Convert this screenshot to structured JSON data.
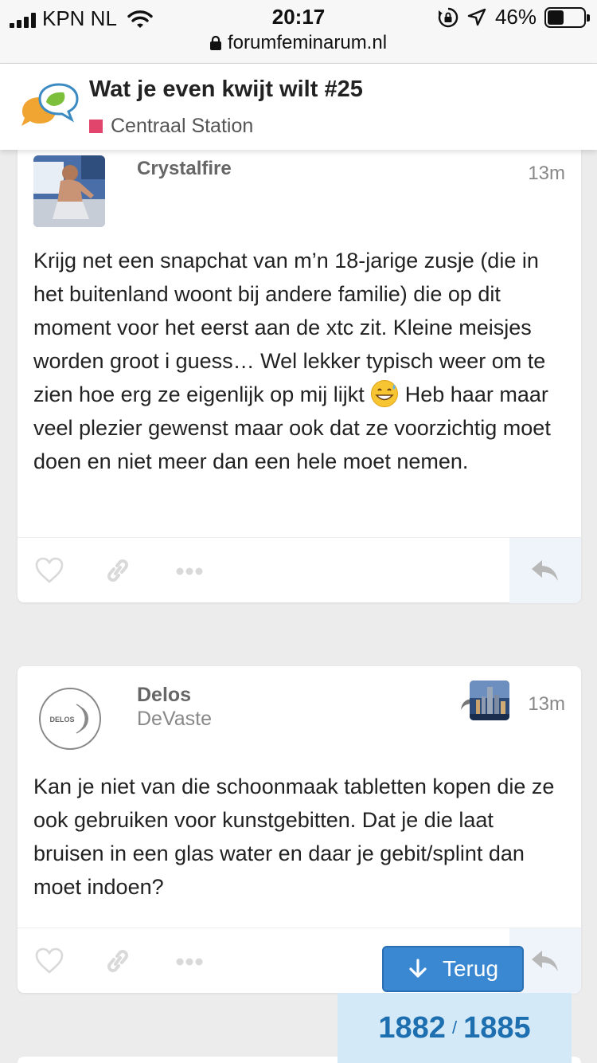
{
  "status_bar": {
    "carrier": "KPN NL",
    "time": "20:17",
    "battery_percent": "46%",
    "battery_level": 0.46,
    "url": "forumfeminarum.nl",
    "icons": [
      "signal-icon",
      "wifi-icon",
      "rotation-lock-icon",
      "location-arrow-icon",
      "battery-icon",
      "lock-icon"
    ]
  },
  "topic": {
    "title": "Wat je even kwijt wilt #25",
    "category": "Centraal Station",
    "category_color": "#e2456c"
  },
  "posts": [
    {
      "username": "Crystalfire",
      "time": "13m",
      "body_parts": [
        "Krijg net een snapchat van m’n 18-jarige zusje (die in het buitenland woont bij andere familie) die op dit moment voor het eerst aan de xtc zit. Kleine meisjes worden groot i guess… Wel lekker typisch weer om te zien hoe erg ze eigenlijk op mij lijkt",
        "Heb haar maar veel plezier gewenst maar ook dat ze voorzichtig moet doen en niet meer dan een hele moet nemen."
      ],
      "emoji": "grinning-sweat-emoji"
    },
    {
      "username": "Delos",
      "user_title": "DeVaste",
      "avatar_text": "DELOS",
      "time": "13m",
      "body": "Kan je niet van die schoonmaak tabletten kopen die ze ook gebruiken voor kunstgebitten. Dat je die laat bruisen in een glas water en daar je gebit/splint dan moet indoen?"
    }
  ],
  "navigation": {
    "back_label": "Terug",
    "progress_current": "1882",
    "progress_separator": "/",
    "progress_total": "1885"
  },
  "colors": {
    "accent_blue": "#3b88d2",
    "progress_bg": "#d4e9f8",
    "progress_text": "#1d6fb0"
  }
}
